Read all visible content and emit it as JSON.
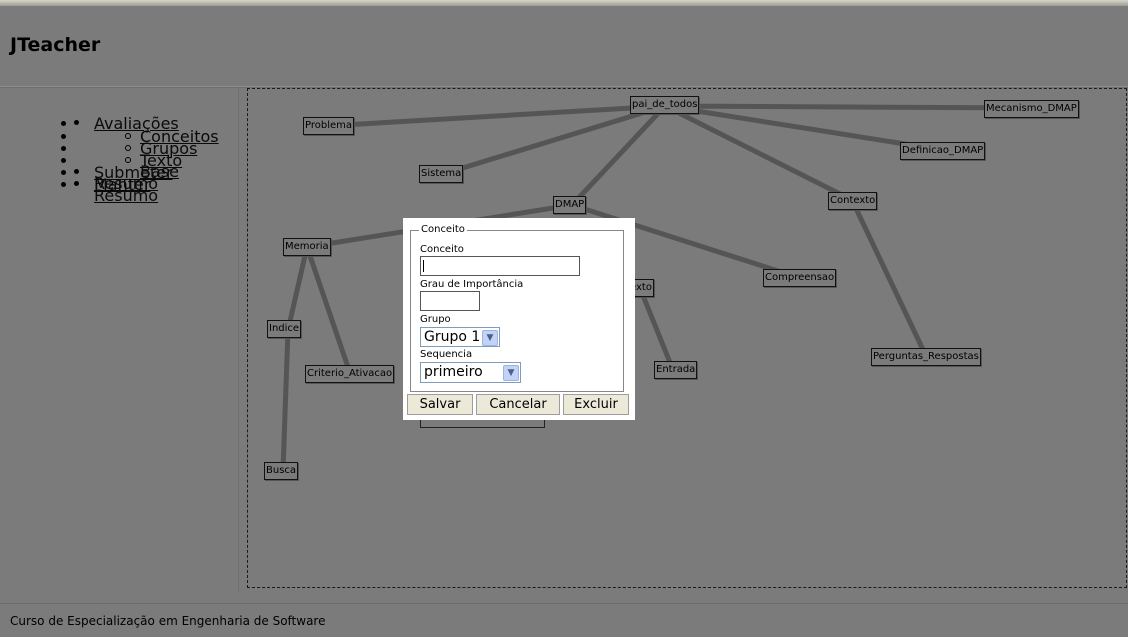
{
  "app": {
    "title": "JTeacher"
  },
  "sidebar": {
    "items": [
      {
        "label": "Avaliações",
        "children": [
          {
            "label": "Conceitos"
          },
          {
            "label": "Grupos"
          },
          {
            "label": "Texto Base"
          }
        ]
      },
      {
        "label": "Submeter Resumo"
      },
      {
        "label": "Manter Resumo"
      }
    ]
  },
  "graph": {
    "nodes": [
      {
        "label": "pai_de_todos"
      },
      {
        "label": "Mecanismo_DMAP"
      },
      {
        "label": "Problema"
      },
      {
        "label": "Definicao_DMAP"
      },
      {
        "label": "Sistema"
      },
      {
        "label": "Contexto"
      },
      {
        "label": "DMAP"
      },
      {
        "label": "Memoria"
      },
      {
        "label": "Compreensao"
      },
      {
        "label": "exto"
      },
      {
        "label": "Indice"
      },
      {
        "label": "Perguntas_Respostas"
      },
      {
        "label": "Criterio_Ativacao"
      },
      {
        "label": "Entrada"
      },
      {
        "label": "Busca"
      }
    ]
  },
  "dialog": {
    "legend": "Conceito",
    "concept_label": "Conceito",
    "concept_value": "",
    "importance_label": "Grau de Importância",
    "importance_value": "",
    "group_label": "Grupo",
    "group_selected": "Grupo 1",
    "sequence_label": "Sequencia",
    "sequence_selected": "primeiro",
    "save_label": "Salvar",
    "cancel_label": "Cancelar",
    "delete_label": "Excluir"
  },
  "footer": {
    "text": "Curso de Especialização em Engenharia de Software"
  },
  "colors": {
    "overlay": "#7b7b7b",
    "edge": "#555555",
    "dialog_bg": "#ffffff",
    "button_bg": "#ece9d8"
  }
}
